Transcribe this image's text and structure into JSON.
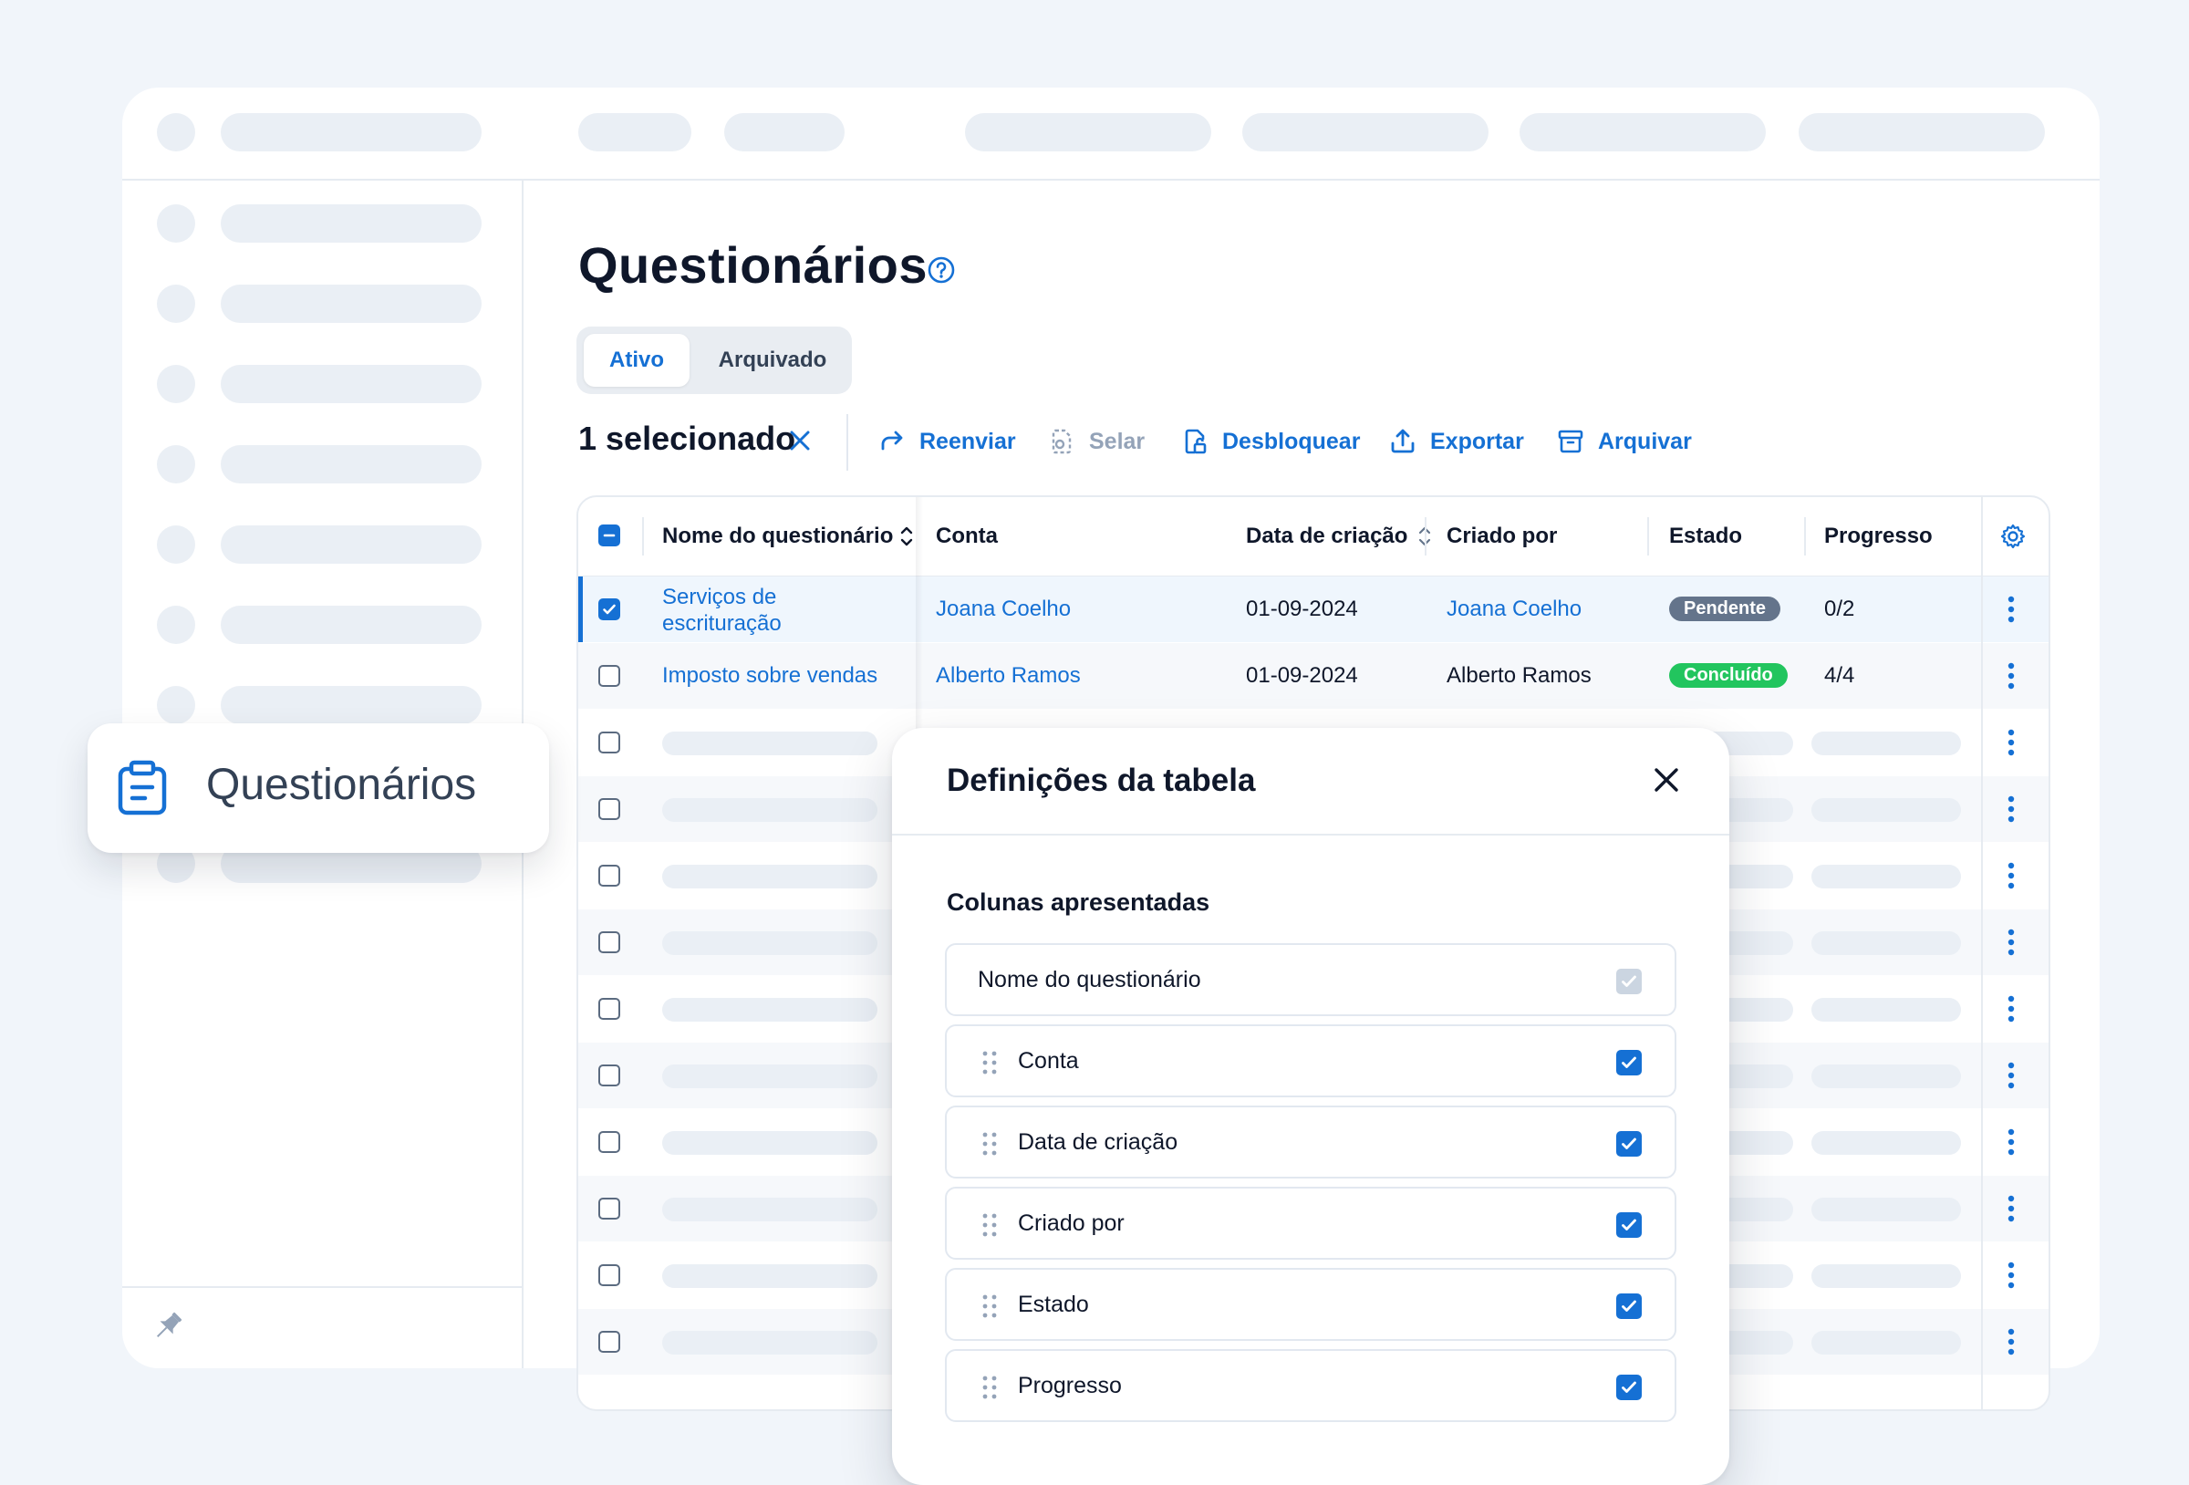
{
  "page": {
    "title": "Questionários"
  },
  "tabs": [
    {
      "label": "Ativo",
      "active": true
    },
    {
      "label": "Arquivado",
      "active": false
    }
  ],
  "selection": {
    "count_label": "1 selecionado"
  },
  "actions": [
    {
      "label": "Reenviar",
      "icon": "redo-arrow-icon",
      "enabled": true
    },
    {
      "label": "Selar",
      "icon": "seal-document-icon",
      "enabled": false
    },
    {
      "label": "Desbloquear",
      "icon": "unlock-document-icon",
      "enabled": true
    },
    {
      "label": "Exportar",
      "icon": "upload-icon",
      "enabled": true
    },
    {
      "label": "Arquivar",
      "icon": "archive-box-icon",
      "enabled": true
    }
  ],
  "table": {
    "columns": [
      "Nome do questionário",
      "Conta",
      "Data de criação",
      "Criado por",
      "Estado",
      "Progresso"
    ],
    "rows": [
      {
        "name_line1": "Serviços de",
        "name_line2": "escrituração",
        "account": "Joana Coelho",
        "created": "01-09-2024",
        "created_by": "Joana Coelho",
        "status": "Pendente",
        "progress": "0/2",
        "selected": true
      },
      {
        "name_line1": "Imposto sobre vendas",
        "name_line2": "",
        "account": "Alberto Ramos",
        "created": "01-09-2024",
        "created_by": "Alberto Ramos",
        "status": "Concluído",
        "progress": "4/4",
        "selected": false
      }
    ]
  },
  "nav_card": {
    "label": "Questionários",
    "icon": "clipboard-icon"
  },
  "modal": {
    "title": "Definições da tabela",
    "subtitle": "Colunas apresentadas",
    "columns": [
      {
        "label": "Nome do questionário",
        "checked": true,
        "locked": true
      },
      {
        "label": "Conta",
        "checked": true,
        "locked": false
      },
      {
        "label": "Data de criação",
        "checked": true,
        "locked": false
      },
      {
        "label": "Criado por",
        "checked": true,
        "locked": false
      },
      {
        "label": "Estado",
        "checked": true,
        "locked": false
      },
      {
        "label": "Progresso",
        "checked": true,
        "locked": false
      }
    ]
  },
  "colors": {
    "accent": "#1570d4",
    "pending_badge": "#64748b",
    "done_badge": "#22c55e"
  }
}
